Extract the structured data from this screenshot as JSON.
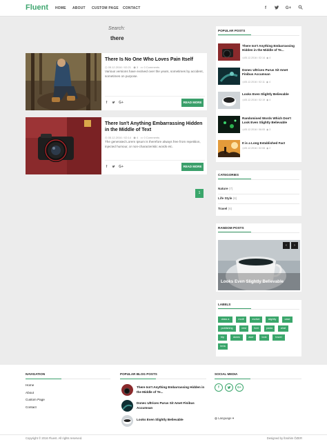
{
  "header": {
    "logo": "Fluent",
    "nav": [
      "HOME",
      "ABOUT",
      "CUSTOM PAGE",
      "CONTACT"
    ],
    "icons": [
      "facebook-icon",
      "twitter-icon",
      "google-plus-icon",
      "search-icon"
    ]
  },
  "search": {
    "label": "Search:",
    "term": "there"
  },
  "posts": [
    {
      "title": "There Is No One Who Loves Pain Itself",
      "date": "05.12.2016 / 02:21",
      "views": "3",
      "comments": "0 Comments",
      "excerpt": "Various versions have evolved over the years, sometimes by accident, sometimes on purpose.",
      "read_more": "READ MORE"
    },
    {
      "title": "There Isn't Anything Embarrassing Hidden in the Middle of Text",
      "date": "05.12.2016 / 02:14",
      "views": "4",
      "comments": "0 Comments",
      "excerpt": "The generated Lorem Ipsum is therefore always free from repetition, injected humour, or non-characteristic words etc.",
      "read_more": "READ MORE"
    }
  ],
  "pager": {
    "current": "1"
  },
  "popular": {
    "title": "POPULAR POSTS",
    "items": [
      {
        "title": "There Isn't Anything Embarrassing Hidden in the Middle of Te...",
        "date": "05.12.2016 / 02:14",
        "views": "4"
      },
      {
        "title": "Donec Ultrices Purus Sit Amet Finibus Accumsan",
        "date": "05.12.2016 / 02:11",
        "views": "4"
      },
      {
        "title": "Looks Even Slightly Believable",
        "date": "05.12.2016 / 02:19",
        "views": "4"
      },
      {
        "title": "Randomised Words Which Don't Look Even Slightly Believable",
        "date": "05.12.2016 / 06:05",
        "views": "3"
      },
      {
        "title": "It is a Long Established Fact",
        "date": "05.12.2016 / 02:08",
        "views": "2"
      }
    ]
  },
  "categories": {
    "title": "CATEGORIES",
    "items": [
      {
        "name": "Nature",
        "count": "(7)"
      },
      {
        "name": "Life Style",
        "count": "(6)"
      },
      {
        "name": "Travel",
        "count": "(6)"
      }
    ]
  },
  "random": {
    "title": "RANDOM POSTS",
    "caption": "Looks Even Slightly Believable"
  },
  "labels": {
    "title": "LABELS",
    "tags": [
      "class a",
      "motif",
      "evolve",
      "slightly",
      "case",
      "publishing",
      "vest",
      "font",
      "pasta",
      "alrat",
      "trip",
      "donec",
      "aser",
      "look",
      "travel",
      "teria"
    ]
  },
  "footer": {
    "navigation": {
      "title": "NAVIGATION",
      "links": [
        "Home",
        "About",
        "Custom Page",
        "Contact"
      ]
    },
    "popular": {
      "title": "POPULAR BLOG POSTS",
      "items": [
        "There Isn't Anything Embarrassing Hidden in the Middle of Te...",
        "Donec Ultrices Purus Sit Amet Finibus Accumsan",
        "Looks Even Slightly Believable"
      ]
    },
    "social": {
      "title": "SOCIAL MEDIA",
      "language": "Language"
    }
  },
  "bottom": {
    "copyright": "Copyright © 2016 Fluent. All rights reserved.",
    "designed": "Designed by İbrahim ÖZER"
  },
  "colors": {
    "accent": "#3a9f6a",
    "logo": "#3fa66f"
  }
}
